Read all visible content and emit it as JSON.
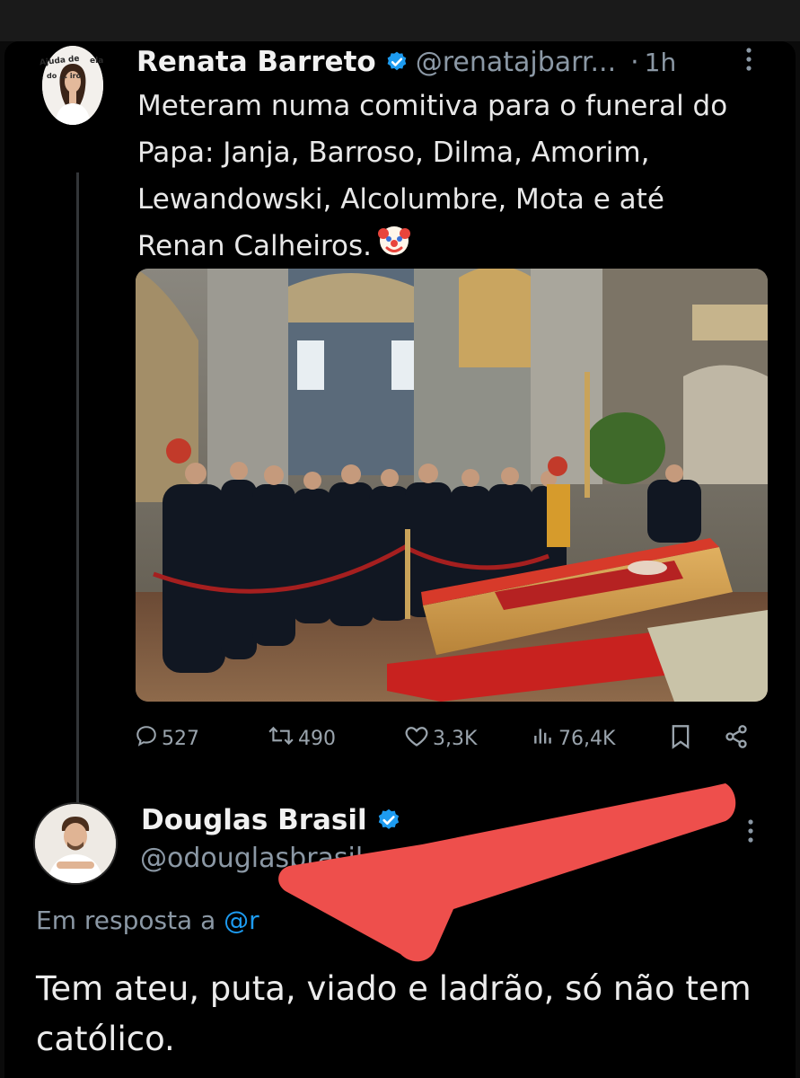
{
  "tweet": {
    "author_name": "Renata Barreto",
    "author_handle": "@renatajbarr...",
    "separator": "·",
    "time": "1h",
    "text": "Meteram numa comitiva para o funeral do Papa: Janja, Barroso, Dilma, Amorim, Lewandowski, Alcolumbre, Mota e até Renan Calheiros.",
    "emoji": "clown-face-icon",
    "avatar_caption_left": "Ajuda de",
    "avatar_caption_right": "ela",
    "avatar_caption_bottom": "do ... iro",
    "stats": {
      "replies": "527",
      "reposts": "490",
      "likes": "3,3K",
      "views": "76,4K"
    }
  },
  "reply": {
    "author_name": "Douglas Brasil",
    "author_handle": "@odouglasbrasil",
    "in_reply_to_label": "Em resposta a",
    "in_reply_to_mention": "@r",
    "text": "Tem ateu, puta, viado e ladrão, só não tem católico."
  },
  "colors": {
    "background": "#000000",
    "verified_badge": "#1d9bf0",
    "handle_gray": "#8b98a5",
    "annotation_arrow": "#ee4f4c"
  },
  "icons": [
    "verified-badge-icon",
    "more-options-icon",
    "reply-icon",
    "repost-icon",
    "like-icon",
    "views-icon",
    "bookmark-icon",
    "share-icon"
  ]
}
